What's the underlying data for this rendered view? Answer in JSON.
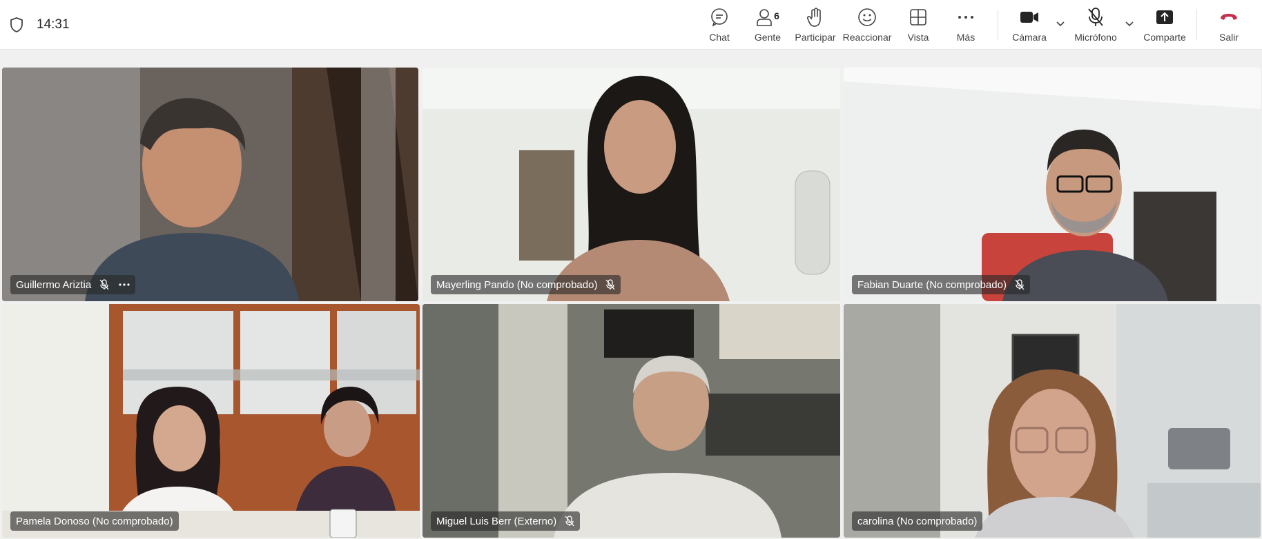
{
  "header": {
    "time": "14:31"
  },
  "toolbar": {
    "chat": "Chat",
    "people": "Gente",
    "people_count": "6",
    "raise": "Participar",
    "react": "Reaccionar",
    "view": "Vista",
    "more": "Más",
    "camera": "Cámara",
    "mic": "Micrófono",
    "share": "Comparte",
    "leave": "Salir"
  },
  "colors": {
    "accent": "#7a5fd6",
    "leave": "#c4314b"
  },
  "participants": [
    {
      "name": "Guillermo Ariztia",
      "muted": true,
      "more": true
    },
    {
      "name": "Mayerling Pando (No comprobado)",
      "muted": true
    },
    {
      "name": "Fabian Duarte (No comprobado)",
      "muted": true
    },
    {
      "name": "Pamela Donoso (No comprobado)",
      "muted": false
    },
    {
      "name": "Miguel Luis Berr (Externo)",
      "muted": true
    },
    {
      "name": "carolina (No comprobado)",
      "muted": false,
      "active_speaker": true
    }
  ]
}
